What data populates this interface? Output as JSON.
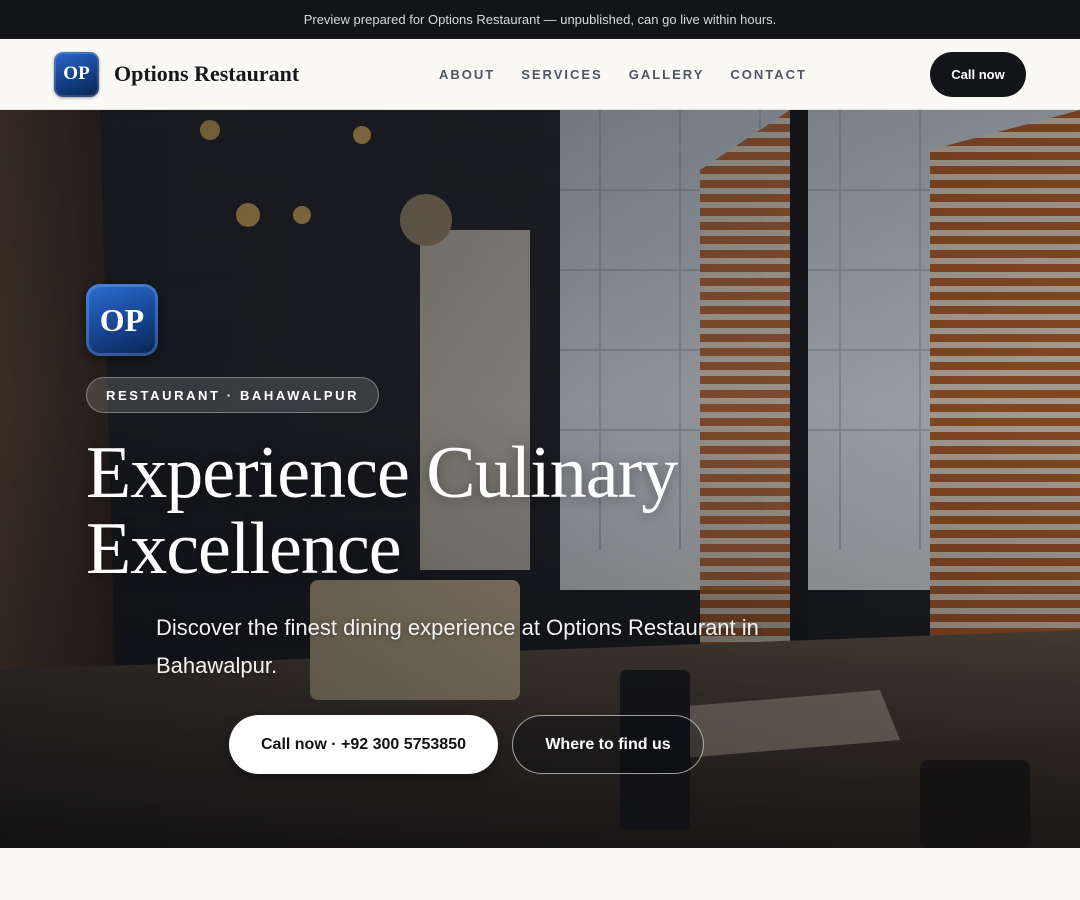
{
  "banner": {
    "text": "Preview prepared for Options Restaurant — unpublished, can go live within hours."
  },
  "header": {
    "logo_initials": "OP",
    "brand_name": "Options Restaurant",
    "nav": [
      {
        "label": "ABOUT"
      },
      {
        "label": "SERVICES"
      },
      {
        "label": "GALLERY"
      },
      {
        "label": "CONTACT"
      }
    ],
    "cta_label": "Call now"
  },
  "hero": {
    "logo_initials": "OP",
    "tag": "RESTAURANT · BAHAWALPUR",
    "headline_line1": "Experience Culinary",
    "headline_line2": "Excellence",
    "subtext": "Discover the finest dining experience at Options Restaurant in Bahawalpur.",
    "primary_cta": "Call now · +92 300 5753850",
    "secondary_cta": "Where to find us"
  },
  "colors": {
    "banner_bg": "#121418",
    "page_bg": "#faf9f6",
    "brand_blue": "#16448f",
    "cta_dark": "#121418"
  }
}
